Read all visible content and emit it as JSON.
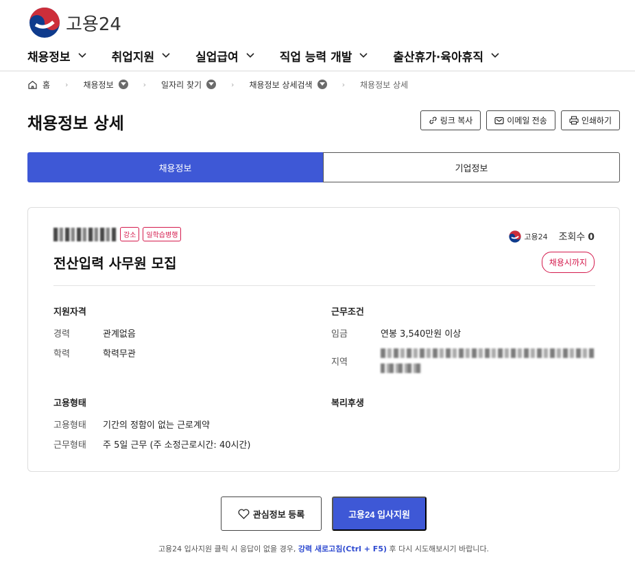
{
  "brand": {
    "name": "고용24",
    "logo_icon": "taegeuk-logo-icon",
    "colors": {
      "red": "#cd2e3a",
      "blue": "#0f3b8c"
    }
  },
  "nav": {
    "items": [
      {
        "label": "채용정보"
      },
      {
        "label": "취업지원"
      },
      {
        "label": "실업급여"
      },
      {
        "label": "직업 능력 개발"
      },
      {
        "label": "출산휴가·육아휴직"
      }
    ]
  },
  "breadcrumb": {
    "home": "홈",
    "items": [
      "채용정보",
      "일자리 찾기",
      "채용정보 상세검색"
    ],
    "current": "채용정보 상세"
  },
  "page": {
    "title": "채용정보 상세",
    "tools": {
      "link_copy": "링크 복사",
      "email": "이메일 전송",
      "print": "인쇄하기"
    }
  },
  "tabs": {
    "active": "채용정보",
    "other": "기업정보"
  },
  "job": {
    "badges": [
      "강소",
      "일학습병행"
    ],
    "source_logo_text": "고용24",
    "views_label": "조회수",
    "views_count": "0",
    "title": "전산입력 사무원 모집",
    "deadline": "채용시까지",
    "qualification": {
      "title": "지원자격",
      "experience_label": "경력",
      "experience_value": "관계없음",
      "education_label": "학력",
      "education_value": "학력무관"
    },
    "conditions": {
      "title": "근무조건",
      "wage_label": "임금",
      "wage_value": "연봉 3,540만원 이상",
      "region_label": "지역"
    },
    "employment": {
      "title": "고용형태",
      "type_label": "고용형태",
      "type_value": "기간의 정함이 없는 근로계약",
      "work_label": "근무형태",
      "work_value": "주 5일 근무 (주 소정근로시간: 40시간)"
    },
    "welfare": {
      "title": "복리후생"
    }
  },
  "actions": {
    "interest": "관심정보 등록",
    "apply": "고용24 입사지원"
  },
  "notice": {
    "before": "고용24 입사지원 클릭 시 응답이 없을 경우, ",
    "emphasis": "강력 새로고침(Ctrl + F5)",
    "after": " 후 다시 시도해보시기 바랍니다."
  },
  "accent_color": "#3e58d6",
  "badge_color": "#d4184b"
}
